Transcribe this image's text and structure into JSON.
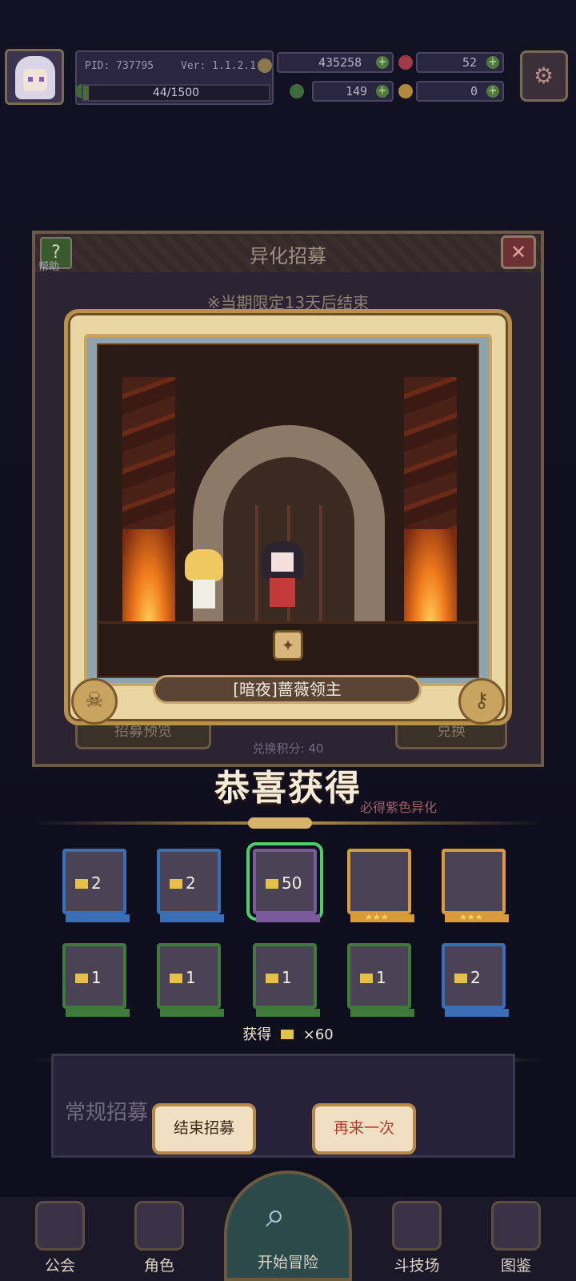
{
  "hud": {
    "pid": "PID: 737795",
    "version": "Ver: 1.1.2.1",
    "exp_text": "44/1500",
    "exp_progress": 0.029,
    "gold": "435258",
    "gems": "52",
    "clover": "149",
    "tickets": "0"
  },
  "panel": {
    "title": "异化招募",
    "help_label": "帮助",
    "limited_notice": "※当期限定13天后结束",
    "preview_button": "招募预览",
    "exchange_button": "兑换",
    "exchange_points": "兑换积分: 40",
    "guarantee_hint": "必得紫色异化"
  },
  "reward": {
    "character_name": "[暗夜]蔷薇领主"
  },
  "congrats": "恭喜获得",
  "items": [
    {
      "count": "2",
      "stars": "",
      "accent": "#3a6fb8"
    },
    {
      "count": "2",
      "stars": "",
      "accent": "#3a6fb8"
    },
    {
      "count": "50",
      "stars": "",
      "accent": "#7a5a9a"
    },
    {
      "count": "",
      "stars": "★★★",
      "accent": "#d99a3a"
    },
    {
      "count": "",
      "stars": "★★★",
      "accent": "#d99a3a"
    },
    {
      "count": "1",
      "stars": "",
      "accent": "#3e7a3a"
    },
    {
      "count": "1",
      "stars": "",
      "accent": "#3e7a3a"
    },
    {
      "count": "1",
      "stars": "",
      "accent": "#3e7a3a"
    },
    {
      "count": "1",
      "stars": "",
      "accent": "#3e7a3a"
    },
    {
      "count": "2",
      "stars": "",
      "accent": "#3a6fb8"
    }
  ],
  "obtained": {
    "label": "获得",
    "amount": "×60"
  },
  "buttons": {
    "end": "结束招募",
    "again": "再来一次"
  },
  "normal_recruit": "常规招募",
  "nav": {
    "guild": "公会",
    "character": "角色",
    "adventure": "开始冒险",
    "arena": "斗技场",
    "codex": "图鉴"
  }
}
